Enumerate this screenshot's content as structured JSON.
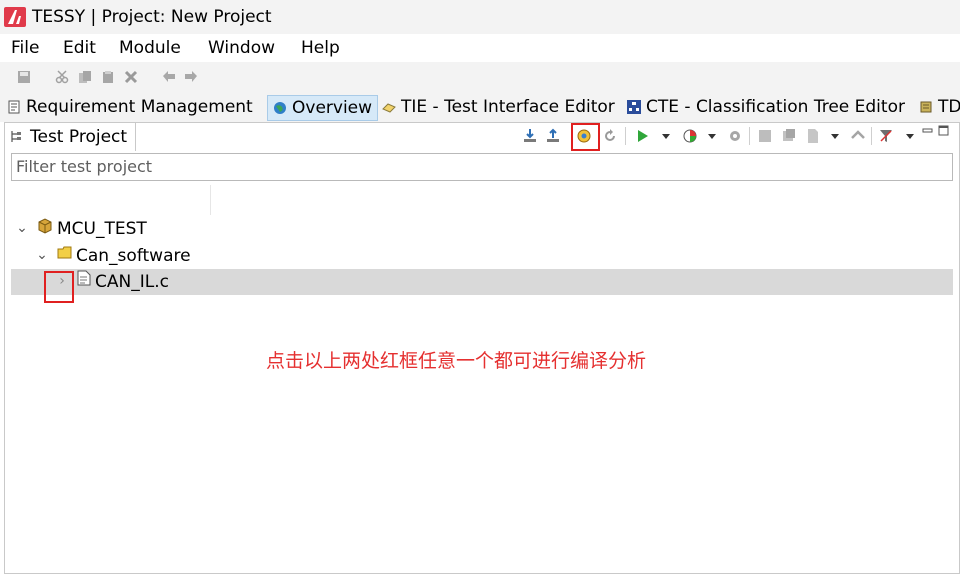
{
  "window": {
    "title": "TESSY | Project: New Project"
  },
  "menu": {
    "items": [
      "File",
      "Edit",
      "Module",
      "Window",
      "Help"
    ]
  },
  "perspectives": [
    {
      "label": "Requirement Management",
      "icon": "requirement-icon",
      "active": false
    },
    {
      "label": "Overview",
      "icon": "globe-icon",
      "active": true
    },
    {
      "label": "TIE - Test Interface Editor",
      "icon": "tie-icon",
      "active": false
    },
    {
      "label": "CTE - Classification Tree Editor",
      "icon": "cte-icon",
      "active": false
    },
    {
      "label": "TD",
      "icon": "td-icon",
      "active": false
    }
  ],
  "view": {
    "title": "Test Project",
    "filter_placeholder": "Filter test project",
    "tree": [
      {
        "label": "MCU_TEST",
        "icon": "project-icon",
        "expanded": true,
        "level": 0
      },
      {
        "label": "Can_software",
        "icon": "folder-icon",
        "expanded": true,
        "level": 1
      },
      {
        "label": "CAN_IL.c",
        "icon": "file-icon",
        "expanded": false,
        "level": 2,
        "selected": true
      }
    ]
  },
  "annotation": {
    "text": "点击以上两处红框任意一个都可进行编译分析",
    "color": "#e53030"
  },
  "colors": {
    "highlight_box": "#e02020",
    "selected_row": "#d9d9d9",
    "active_perspective": "#d6e9f8"
  }
}
